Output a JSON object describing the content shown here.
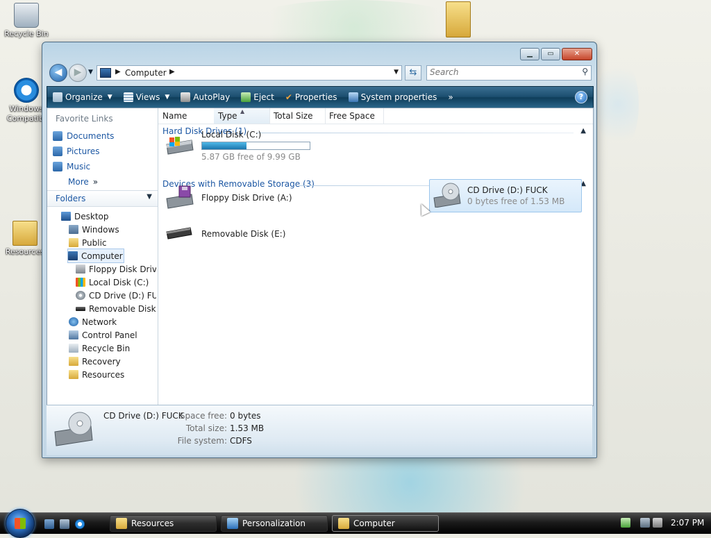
{
  "desktop": {
    "icons": [
      {
        "label": "Recycle Bin"
      },
      {
        "label": "Windows Compatibi"
      },
      {
        "label": "Resources"
      }
    ]
  },
  "window": {
    "caption_buttons": {
      "minimize": "▁",
      "maximize": "▭",
      "close": "✕"
    },
    "address": {
      "crumb": "Computer",
      "separator": "▶"
    },
    "search": {
      "placeholder": "Search"
    },
    "toolbar": {
      "organize": "Organize",
      "views": "Views",
      "autoplay": "AutoPlay",
      "eject": "Eject",
      "properties": "Properties",
      "system_properties": "System properties",
      "more": "»",
      "help": "?"
    },
    "nav": {
      "favorite_links_title": "Favorite Links",
      "favorites": [
        "Documents",
        "Pictures",
        "Music"
      ],
      "more": "More",
      "more_arrow": "»",
      "folders_title": "Folders",
      "tree": [
        "Desktop",
        "Windows",
        "Public",
        "Computer",
        "Floppy Disk Drive",
        "Local Disk (C:)",
        "CD Drive (D:) FUC",
        "Removable Disk (E",
        "Network",
        "Control Panel",
        "Recycle Bin",
        "Recovery",
        "Resources"
      ]
    },
    "columns": [
      "Name",
      "Type",
      "Total Size",
      "Free Space"
    ],
    "groups": {
      "hard_disk": "Hard Disk Drives (1)",
      "removable": "Devices with Removable Storage (3)"
    },
    "drives": {
      "c": {
        "name": "Local Disk (C:)",
        "sub": "5.87 GB free of 9.99 GB",
        "used_fraction": 0.41
      },
      "a": {
        "name": "Floppy Disk Drive (A:)"
      },
      "d": {
        "name": "CD Drive (D:) FUCK",
        "sub": "0 bytes free of 1.53 MB"
      },
      "e": {
        "name": "Removable Disk (E:)"
      }
    },
    "details": {
      "name": "CD Drive (D:) FUCK",
      "space_free_label": "Space free:",
      "space_free": "0 bytes",
      "total_size_label": "Total size:",
      "total_size": "1.53 MB",
      "file_system_label": "File system:",
      "file_system": "CDFS"
    }
  },
  "taskbar": {
    "buttons": [
      "Resources",
      "Personalization",
      "Computer"
    ],
    "clock": "2:07 PM"
  }
}
